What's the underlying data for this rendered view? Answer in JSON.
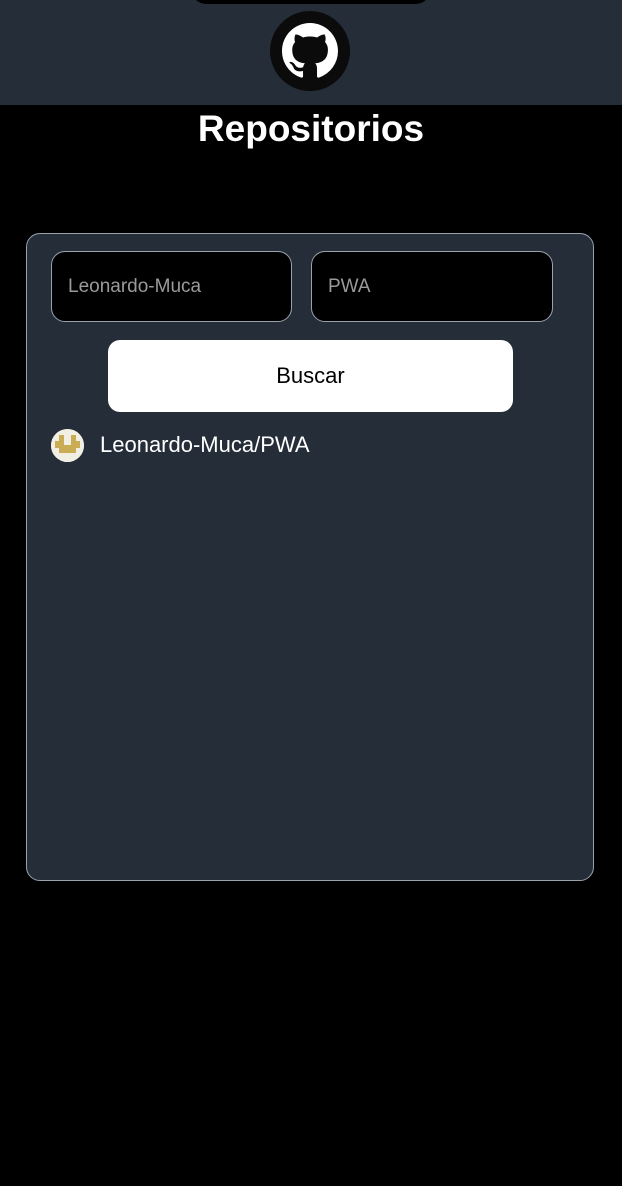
{
  "header": {
    "logo_icon": "github-icon"
  },
  "page": {
    "title": "Repositorios"
  },
  "form": {
    "user_placeholder": "Leonardo-Muca",
    "repo_placeholder": "PWA",
    "search_label": "Buscar"
  },
  "results": [
    {
      "name": "Leonardo-Muca/PWA",
      "avatar_icon": "identicon-avatar"
    }
  ],
  "colors": {
    "background": "#000000",
    "panel": "#242d38",
    "border": "#9aa3ad",
    "button": "#ffffff",
    "avatar_accent": "#c9ac54"
  }
}
